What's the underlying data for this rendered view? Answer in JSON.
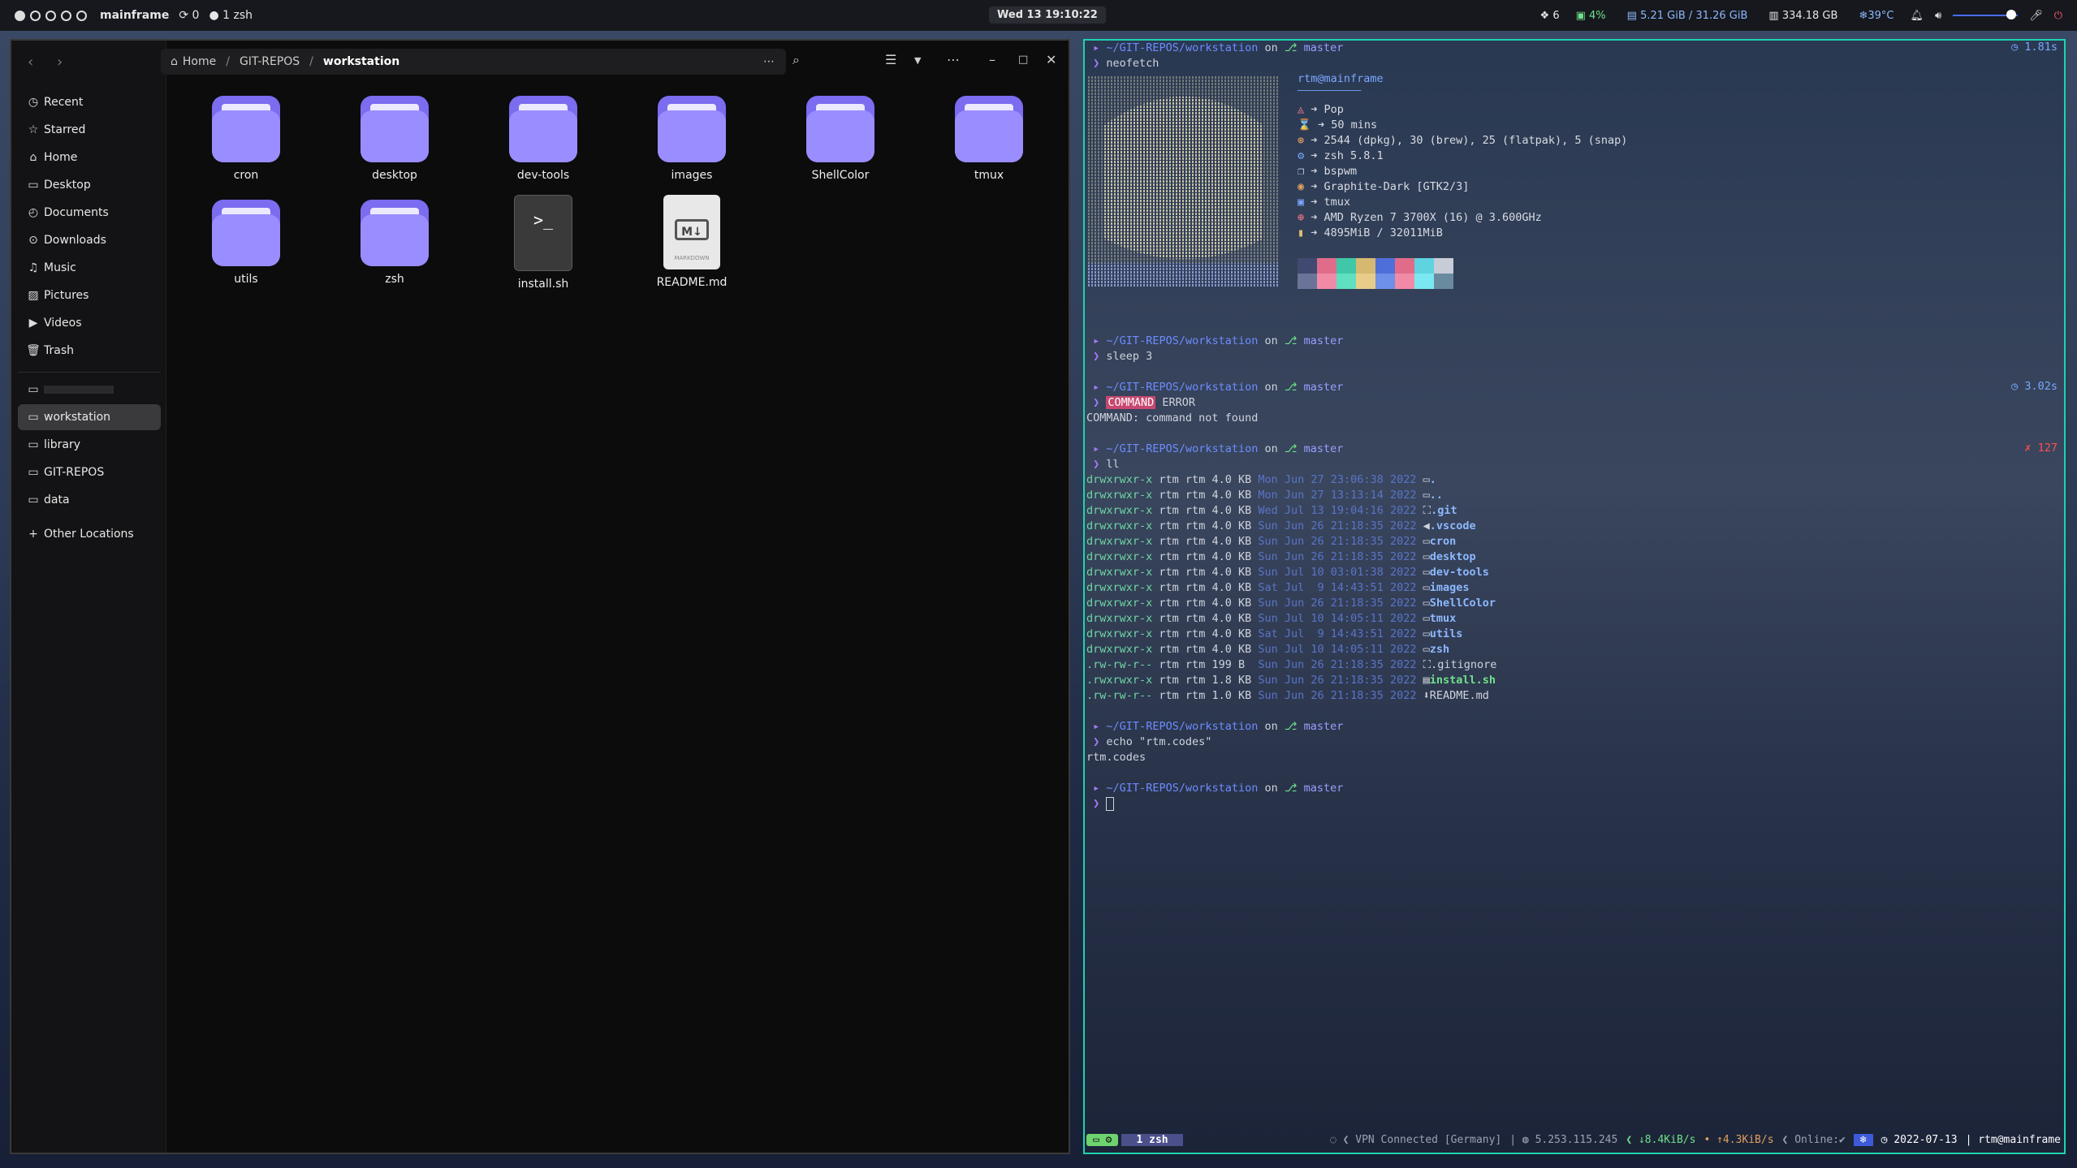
{
  "topbar": {
    "hostname": "mainframe",
    "updates": "0",
    "session": "1 zsh",
    "clock": "Wed 13 19:10:22",
    "dropbox_count": "6",
    "cpu": "4%",
    "memory": "5.21 GiB / 31.26 GiB",
    "disk": "334.18 GB",
    "temperature": "39°C",
    "volume_level": 0.9
  },
  "files": {
    "path": [
      "Home",
      "GIT-REPOS",
      "workstation"
    ],
    "sidebar": [
      {
        "label": "Recent",
        "icon": "clock-icon"
      },
      {
        "label": "Starred",
        "icon": "star-icon"
      },
      {
        "label": "Home",
        "icon": "home-icon"
      },
      {
        "label": "Desktop",
        "icon": "desktop-icon"
      },
      {
        "label": "Documents",
        "icon": "documents-icon"
      },
      {
        "label": "Downloads",
        "icon": "downloads-icon"
      },
      {
        "label": "Music",
        "icon": "music-icon"
      },
      {
        "label": "Pictures",
        "icon": "pictures-icon"
      },
      {
        "label": "Videos",
        "icon": "videos-icon"
      },
      {
        "label": "Trash",
        "icon": "trash-icon"
      }
    ],
    "bookmarks": [
      "workstation",
      "library",
      "GIT-REPOS",
      "data"
    ],
    "other_locations": "Other Locations",
    "items": [
      "cron",
      "desktop",
      "dev-tools",
      "images",
      "ShellColor",
      "tmux",
      "utils",
      "zsh",
      "install.sh",
      "README.md"
    ],
    "markdown_badge": "MARKDOWN"
  },
  "terminal": {
    "prompt_dir": "~/GIT-REPOS/workstation",
    "prompt_on": "on",
    "branch": "master",
    "cmd_neofetch": "neofetch",
    "dur_neofetch": "1.81s",
    "nf_title": "rtm@mainframe",
    "nf_underline": "─────────────",
    "nf_os": "Pop",
    "nf_uptime": "50 mins",
    "nf_packages": "2544 (dpkg), 30 (brew), 25 (flatpak), 5 (snap)",
    "nf_shell": "zsh 5.8.1",
    "nf_wm": "bspwm",
    "nf_theme": "Graphite-Dark [GTK2/3]",
    "nf_term": "tmux",
    "nf_cpu": "AMD Ryzen 7 3700X (16) @ 3.600GHz",
    "nf_mem": "4895MiB / 32011MiB",
    "cmd_sleep": "sleep 3",
    "cmd_error": "COMMAND",
    "cmd_error_arg": " ERROR",
    "dur_error": "3.02s",
    "error_output": "COMMAND: command not found",
    "cmd_ll": "ll",
    "ll_status": "✗ 127",
    "ll_rows": [
      {
        "perm": "drwxrwxr-x",
        "size": "4.0 KB",
        "date": "Mon Jun 27 23:06:38 2022",
        "name": "."
      },
      {
        "perm": "drwxrwxr-x",
        "size": "4.0 KB",
        "date": "Mon Jun 27 13:13:14 2022",
        "name": ".."
      },
      {
        "perm": "drwxrwxr-x",
        "size": "4.0 KB",
        "date": "Wed Jul 13 19:04:16 2022",
        "name": ".git"
      },
      {
        "perm": "drwxrwxr-x",
        "size": "4.0 KB",
        "date": "Sun Jun 26 21:18:35 2022",
        "name": ".vscode"
      },
      {
        "perm": "drwxrwxr-x",
        "size": "4.0 KB",
        "date": "Sun Jun 26 21:18:35 2022",
        "name": "cron"
      },
      {
        "perm": "drwxrwxr-x",
        "size": "4.0 KB",
        "date": "Sun Jun 26 21:18:35 2022",
        "name": "desktop"
      },
      {
        "perm": "drwxrwxr-x",
        "size": "4.0 KB",
        "date": "Sun Jul 10 03:01:38 2022",
        "name": "dev-tools"
      },
      {
        "perm": "drwxrwxr-x",
        "size": "4.0 KB",
        "date": "Sat Jul  9 14:43:51 2022",
        "name": "images"
      },
      {
        "perm": "drwxrwxr-x",
        "size": "4.0 KB",
        "date": "Sun Jun 26 21:18:35 2022",
        "name": "ShellColor"
      },
      {
        "perm": "drwxrwxr-x",
        "size": "4.0 KB",
        "date": "Sun Jul 10 14:05:11 2022",
        "name": "tmux"
      },
      {
        "perm": "drwxrwxr-x",
        "size": "4.0 KB",
        "date": "Sat Jul  9 14:43:51 2022",
        "name": "utils"
      },
      {
        "perm": "drwxrwxr-x",
        "size": "4.0 KB",
        "date": "Sun Jul 10 14:05:11 2022",
        "name": "zsh"
      },
      {
        "perm": ".rw-rw-r--",
        "size": "199 B ",
        "date": "Sun Jun 26 21:18:35 2022",
        "name": ".gitignore"
      },
      {
        "perm": ".rwxrwxr-x",
        "size": "1.8 KB",
        "date": "Sun Jun 26 21:18:35 2022",
        "name": "install.sh"
      },
      {
        "perm": ".rw-rw-r--",
        "size": "1.0 KB",
        "date": "Sun Jun 26 21:18:35 2022",
        "name": "README.md"
      }
    ],
    "ll_owner": "rtm rtm",
    "cmd_echo": "echo \"rtm.codes\"",
    "echo_output": "rtm.codes",
    "status": {
      "window": "1 zsh",
      "vpn": "VPN Connected [Germany]",
      "ip": "5.253.115.245",
      "down": "↓8.4KiB/s",
      "up": "↑4.3KiB/s",
      "online": "Online:✔",
      "date": "2022-07-13",
      "user": "rtm@mainframe"
    },
    "colors": {
      "accent": "#1dd3b0",
      "folder": "#9a8dff"
    }
  }
}
